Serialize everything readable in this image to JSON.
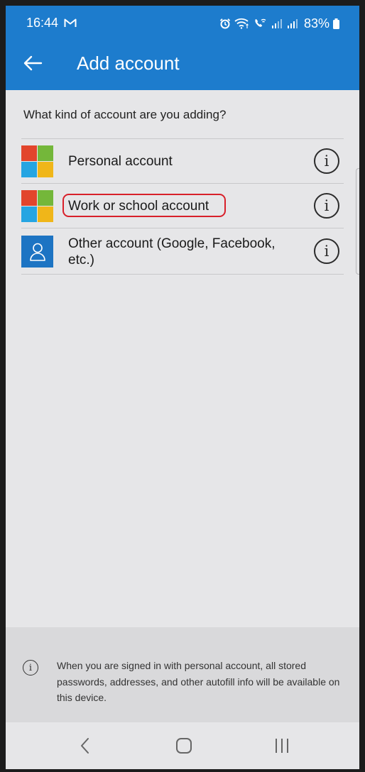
{
  "status_bar": {
    "time": "16:44",
    "battery": "83%",
    "icons": [
      "gmail-icon",
      "alarm-icon",
      "wifi-icon",
      "wifi-calling-icon",
      "signal-icon",
      "signal-icon",
      "battery-icon"
    ]
  },
  "app_bar": {
    "title": "Add account",
    "back_icon": "arrow-left-icon"
  },
  "content": {
    "question": "What kind of account are you adding?",
    "accounts": [
      {
        "label": "Personal account",
        "icon": "microsoft-logo-icon",
        "info_icon": "info-icon"
      },
      {
        "label": "Work or school account",
        "icon": "microsoft-logo-icon",
        "info_icon": "info-icon",
        "highlighted": true
      },
      {
        "label": "Other account (Google, Facebook, etc.)",
        "icon": "person-icon",
        "info_icon": "info-icon"
      }
    ]
  },
  "footer": {
    "icon": "info-icon",
    "note": "When you are signed in with personal account, all stored passwords, addresses, and other autofill info will be available on this device."
  },
  "nav_bar": {
    "buttons": [
      "back-nav-icon",
      "home-nav-icon",
      "recents-nav-icon"
    ]
  },
  "colors": {
    "header_blue": "#1d7ccd",
    "background": "#e6e6e8",
    "highlight_red": "#d8202a",
    "ms_red": "#e2452c",
    "ms_green": "#74b73a",
    "ms_blue": "#26a5e2",
    "ms_yellow": "#f0b619",
    "person_tile_blue": "#1d74c3"
  }
}
